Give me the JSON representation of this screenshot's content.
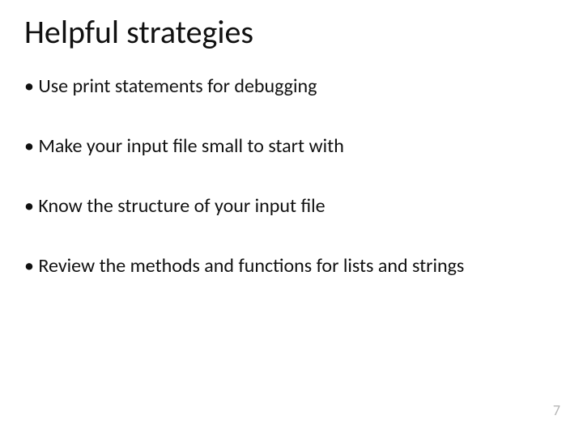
{
  "slide": {
    "title": "Helpful strategies",
    "bullets": [
      "Use print statements for debugging",
      "Make your input file small to start with",
      "Know the structure of your input file",
      "Review the methods and functions for lists and strings"
    ],
    "page_number": "7"
  }
}
